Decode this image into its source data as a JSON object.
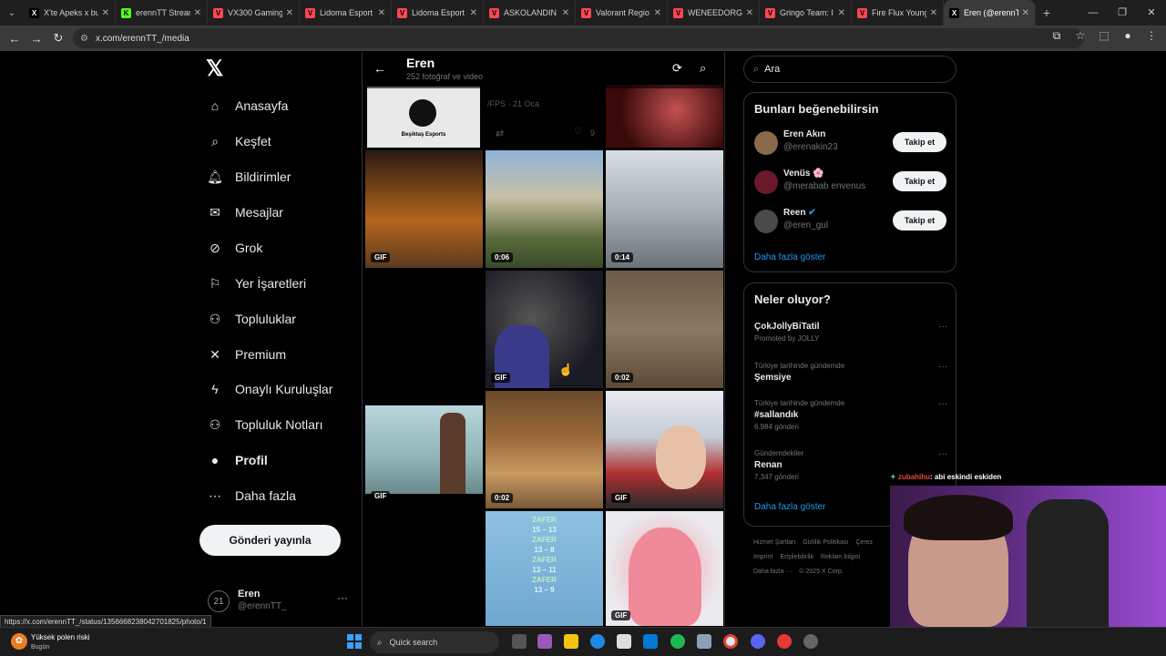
{
  "browser": {
    "tabs": [
      {
        "title": "X'te Apeks x bu",
        "fav_color": "#000000",
        "fav_glyph": "X"
      },
      {
        "title": "erennTT Stream",
        "fav_color": "#53fc18",
        "fav_glyph": "K"
      },
      {
        "title": "VX300 Gaming",
        "fav_color": "#ff4655",
        "fav_glyph": "V"
      },
      {
        "title": "Lidoma Esport",
        "fav_color": "#ff4655",
        "fav_glyph": "V"
      },
      {
        "title": "Lidoma Esport",
        "fav_color": "#ff4655",
        "fav_glyph": "V"
      },
      {
        "title": "ASKOLANDIN",
        "fav_color": "#ff4655",
        "fav_glyph": "V"
      },
      {
        "title": "Valorant Regio",
        "fav_color": "#ff4655",
        "fav_glyph": "V"
      },
      {
        "title": "WENEEDORG",
        "fav_color": "#ff4655",
        "fav_glyph": "V"
      },
      {
        "title": "Gringo Team: I",
        "fav_color": "#ff4655",
        "fav_glyph": "V"
      },
      {
        "title": "Fire Flux Young",
        "fav_color": "#ff4655",
        "fav_glyph": "V"
      },
      {
        "title": "Eren (@erennT",
        "fav_color": "#000000",
        "fav_glyph": "X",
        "active": true
      }
    ],
    "url": "x.com/erennTT_/media",
    "status_url": "https://x.com/erennTT_/status/1356668238042701825/photo/1"
  },
  "nav": {
    "items": [
      {
        "label": "Anasayfa",
        "icon": "home-icon"
      },
      {
        "label": "Keşfet",
        "icon": "search-icon"
      },
      {
        "label": "Bildirimler",
        "icon": "bell-icon"
      },
      {
        "label": "Mesajlar",
        "icon": "mail-icon"
      },
      {
        "label": "Grok",
        "icon": "grok-icon"
      },
      {
        "label": "Yer İşaretleri",
        "icon": "bookmark-icon"
      },
      {
        "label": "Topluluklar",
        "icon": "communities-icon"
      },
      {
        "label": "Premium",
        "icon": "x-icon"
      },
      {
        "label": "Onaylı Kuruluşlar",
        "icon": "lightning-icon"
      },
      {
        "label": "Topluluk Notları",
        "icon": "community-notes-icon"
      },
      {
        "label": "Profil",
        "icon": "profile-icon"
      },
      {
        "label": "Daha fazla",
        "icon": "more-circle-icon"
      }
    ],
    "post_button": "Gönderi yayınla",
    "account": {
      "name": "Eren",
      "handle": "@erennTT_"
    }
  },
  "profile_header": {
    "name": "Eren",
    "subtitle": "252 fotoğraf ve video"
  },
  "media": {
    "ghost_text": "/FPS · 21 Oca",
    "ghost_likes": "9",
    "beşiktaş_label": "Beşiktaş Esports",
    "tiles": [
      {
        "badge": "GIF"
      },
      {
        "badge": "0:06"
      },
      {
        "badge": "0:14"
      },
      {
        "badge": "GIF"
      },
      {
        "badge": "0:02"
      },
      {
        "badge": "GIF"
      },
      {
        "badge": "0:02"
      },
      {
        "badge": "GIF"
      },
      {
        "badge": ""
      },
      {
        "badge": "GIF"
      }
    ],
    "zafer": [
      "ZAFER",
      "15 – 13",
      "ZAFER",
      "13 – 8",
      "ZAFER",
      "13 – 11",
      "ZAFER",
      "13 – 9"
    ]
  },
  "right": {
    "search_placeholder": "Ara",
    "suggest_title": "Bunları beğenebilirsin",
    "suggestions": [
      {
        "name": "Eren Akın",
        "handle": "@erenakin23",
        "button": "Takip et"
      },
      {
        "name": "Venüs 🌸",
        "handle": "@merabab envenus",
        "button": "Takip et"
      },
      {
        "name": "Reen",
        "handle": "@eren_gul",
        "button": "Takip et",
        "verified": true
      }
    ],
    "show_more": "Daha fazla göster",
    "trends_title": "Neler oluyor?",
    "trends": [
      {
        "context": "",
        "title": "ÇokJollyBiTatil",
        "count": "Promoted by JOLLY"
      },
      {
        "context": "Türkiye tarihinde gündemde",
        "title": "Şemsiye",
        "count": ""
      },
      {
        "context": "Türkiye tarihinde gündemde",
        "title": "#sallandık",
        "count": "6.984 gönderi"
      },
      {
        "context": "Gündemdekiler",
        "title": "Renan",
        "count": "7.347 gönderi"
      }
    ],
    "trends_more": "Daha fazla göster",
    "footer": [
      "Hizmet Şartları",
      "Gizlilik Politikası",
      "Çerez",
      "Imprint",
      "Erişilebilirlik",
      "Reklam bilgisi",
      "Daha fazla ···",
      "© 2025 X Corp."
    ]
  },
  "stream": {
    "chat_user": "zubahihu",
    "chat_msg": ": abi eskindi eskiden"
  },
  "taskbar": {
    "weather_title": "Yüksek polen riski",
    "weather_sub": "Bugün",
    "search_label": "Quick search"
  }
}
